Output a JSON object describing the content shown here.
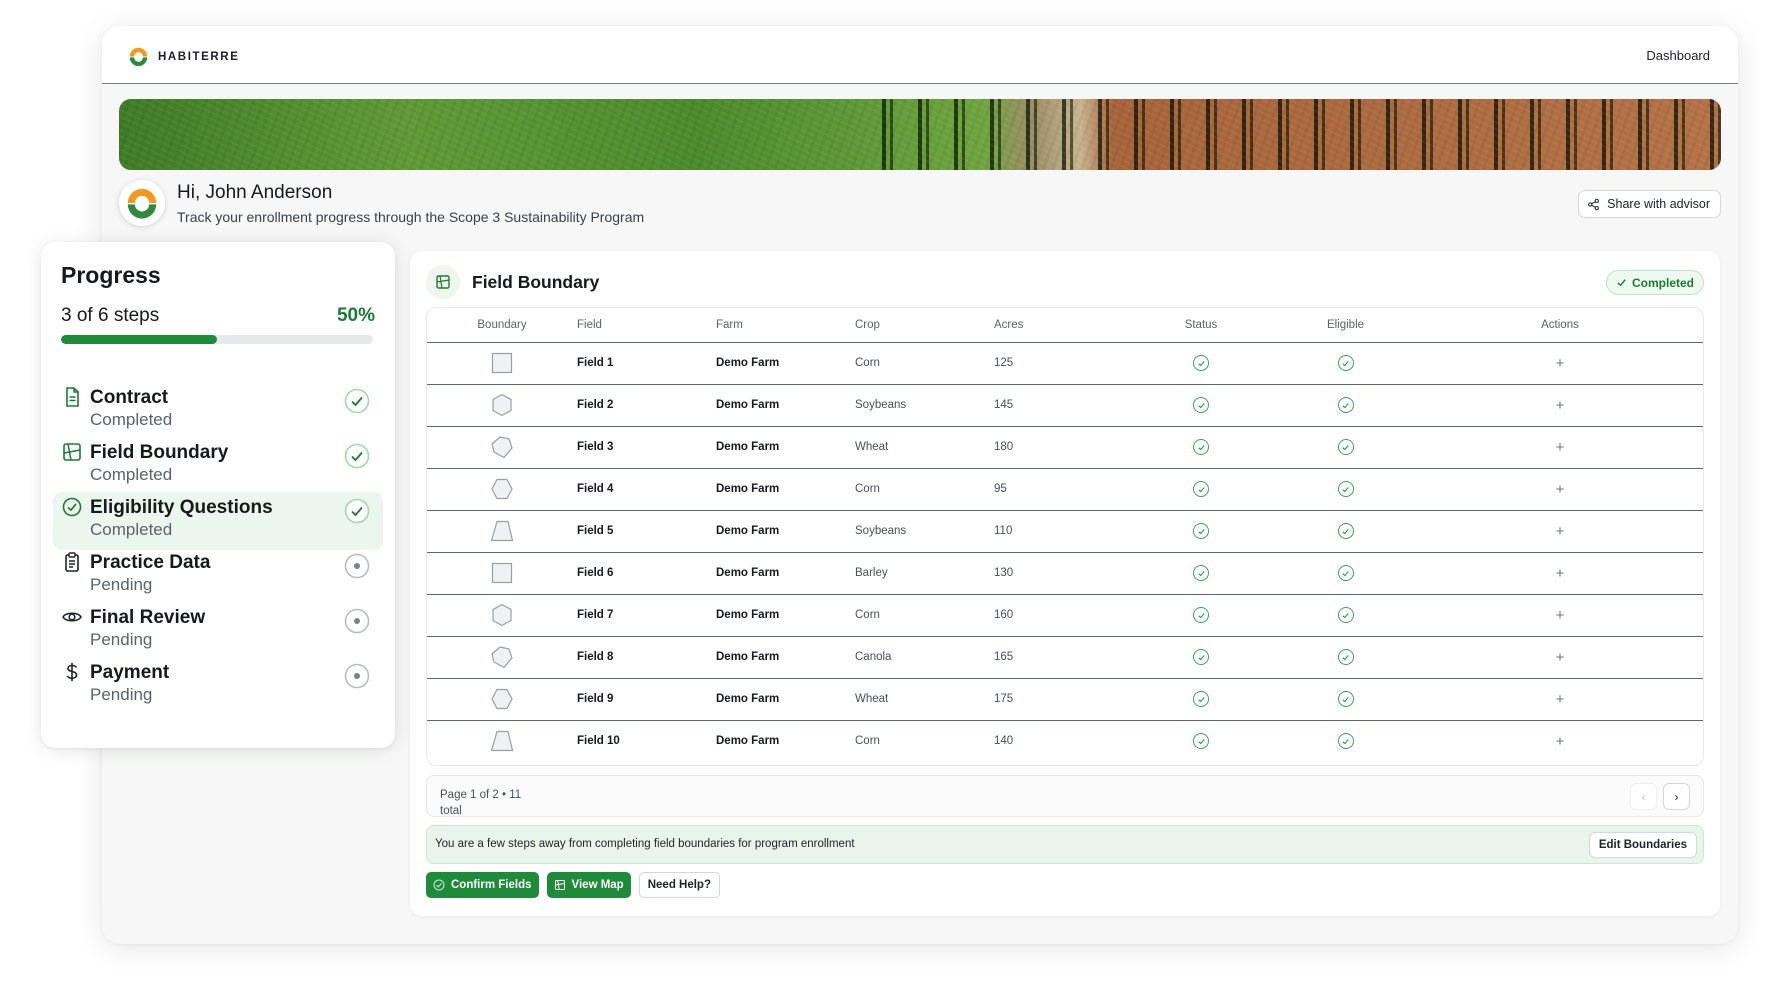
{
  "brand": {
    "name": "HABITERRE"
  },
  "nav": {
    "dashboard": "Dashboard"
  },
  "greeting": {
    "title": "Hi, John Anderson",
    "subtitle": "Track your enrollment progress through the Scope 3 Sustainability Program"
  },
  "share": {
    "label": "Share with advisor"
  },
  "progress": {
    "title": "Progress",
    "steps_text": "3 of 6 steps",
    "percent_text": "50%",
    "fraction": 0.5,
    "steps": [
      {
        "title": "Contract",
        "status": "Completed",
        "icon": "document-icon",
        "done": true
      },
      {
        "title": "Field Boundary",
        "status": "Completed",
        "icon": "map-icon",
        "done": true
      },
      {
        "title": "Eligibility Questions",
        "status": "Completed",
        "icon": "check-circle-icon",
        "done": true,
        "active": true
      },
      {
        "title": "Practice Data",
        "status": "Pending",
        "icon": "clipboard-icon",
        "done": false
      },
      {
        "title": "Final Review",
        "status": "Pending",
        "icon": "eye-icon",
        "done": false
      },
      {
        "title": "Payment",
        "status": "Pending",
        "icon": "dollar-icon",
        "done": false
      }
    ]
  },
  "panel": {
    "title": "Field Boundary",
    "badge": "Completed",
    "columns": [
      "Boundary",
      "Field",
      "Farm",
      "Crop",
      "Acres",
      "Status",
      "Eligible",
      "Actions"
    ],
    "rows": [
      {
        "shape": "square",
        "field": "Field 1",
        "farm": "Demo Farm",
        "crop": "Corn",
        "acres": "125"
      },
      {
        "shape": "hexagon",
        "field": "Field 2",
        "farm": "Demo Farm",
        "crop": "Soybeans",
        "acres": "145"
      },
      {
        "shape": "pentagon",
        "field": "Field 3",
        "farm": "Demo Farm",
        "crop": "Wheat",
        "acres": "180"
      },
      {
        "shape": "hexagon-flat",
        "field": "Field 4",
        "farm": "Demo Farm",
        "crop": "Corn",
        "acres": "95"
      },
      {
        "shape": "trapezoid",
        "field": "Field 5",
        "farm": "Demo Farm",
        "crop": "Soybeans",
        "acres": "110"
      },
      {
        "shape": "square",
        "field": "Field 6",
        "farm": "Demo Farm",
        "crop": "Barley",
        "acres": "130"
      },
      {
        "shape": "hexagon",
        "field": "Field 7",
        "farm": "Demo Farm",
        "crop": "Corn",
        "acres": "160"
      },
      {
        "shape": "pentagon",
        "field": "Field 8",
        "farm": "Demo Farm",
        "crop": "Canola",
        "acres": "165"
      },
      {
        "shape": "hexagon-flat",
        "field": "Field 9",
        "farm": "Demo Farm",
        "crop": "Wheat",
        "acres": "175"
      },
      {
        "shape": "trapezoid",
        "field": "Field 10",
        "farm": "Demo Farm",
        "crop": "Corn",
        "acres": "140"
      }
    ],
    "pagination": {
      "text": "Page 1 of 2 • 11 total"
    },
    "notice": "You are a few steps away from completing field boundaries for program enrollment",
    "edit_label": "Edit Boundaries",
    "confirm_label": "Confirm Fields",
    "map_label": "View Map",
    "help_label": "Need Help?"
  },
  "colors": {
    "accent": "#1f8b3a",
    "accent_light": "#ebf7ee",
    "text": "#17191d"
  }
}
